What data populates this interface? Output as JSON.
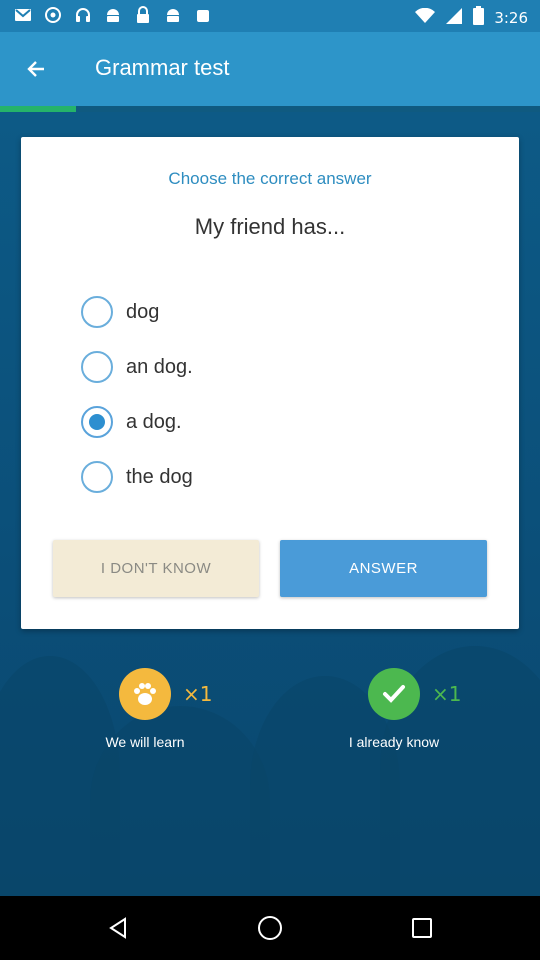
{
  "status_bar": {
    "time": "3:26",
    "icons": [
      "gmail-icon",
      "photos-icon",
      "headset-icon",
      "android-icon",
      "lock-icon",
      "android-icon",
      "android-icon"
    ],
    "right_icons": [
      "wifi-icon",
      "signal-icon",
      "battery-icon"
    ]
  },
  "app_bar": {
    "title": "Grammar test",
    "back_icon": "arrow-back-icon"
  },
  "progress": {
    "fraction": 0.14,
    "color": "#25b36a"
  },
  "card": {
    "instruction": "Choose the correct answer",
    "question": "My friend has...",
    "options": [
      {
        "label": "dog",
        "selected": false
      },
      {
        "label": "an dog.",
        "selected": false
      },
      {
        "label": "a dog.",
        "selected": true
      },
      {
        "label": "the dog",
        "selected": false
      }
    ],
    "dont_know_label": "I DON'T KNOW",
    "answer_label": "ANSWER"
  },
  "stats": {
    "learn": {
      "count": "×1",
      "label": "We will learn",
      "icon": "paw-icon",
      "color": "#f4b93e"
    },
    "know": {
      "count": "×1",
      "label": "I already know",
      "icon": "check-icon",
      "color": "#4cb84f"
    }
  },
  "nav": {
    "back_icon": "nav-back-icon",
    "home_icon": "nav-home-icon",
    "recents_icon": "nav-recents-icon"
  }
}
